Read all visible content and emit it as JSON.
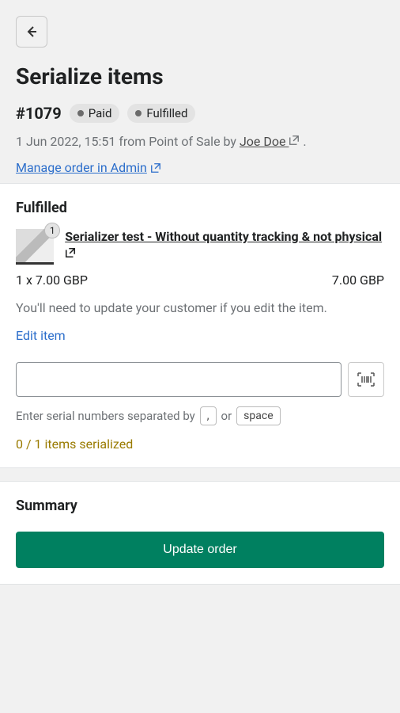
{
  "header": {
    "page_title": "Serialize items",
    "order_number": "#1079",
    "badges": {
      "paid": "Paid",
      "fulfilled": "Fulfilled"
    },
    "meta_prefix": "1 Jun 2022, 15:51 from Point of Sale by ",
    "author": "Joe Doe",
    "meta_suffix": " .",
    "admin_link": "Manage order in Admin"
  },
  "fulfilled": {
    "title": "Fulfilled",
    "item": {
      "qty_badge": "1",
      "name": "Serializer test - Without quantity tracking & not physical",
      "qty_price": "1 x 7.00 GBP",
      "total": "7.00 GBP"
    },
    "help": "You'll need to update your customer if you edit the item.",
    "edit": "Edit item",
    "hint_prefix": "Enter serial numbers separated by",
    "hint_or": "or",
    "key_comma": ",",
    "key_space": "space",
    "status": "0 / 1 items serialized"
  },
  "summary": {
    "title": "Summary",
    "button": "Update order"
  }
}
